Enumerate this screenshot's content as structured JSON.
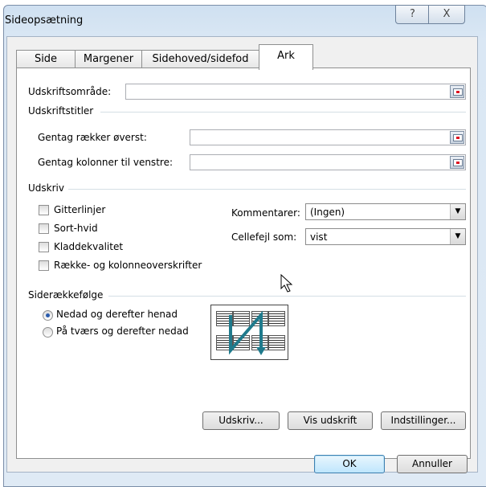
{
  "window": {
    "title": "Sideopsætning",
    "help_glyph": "?",
    "close_glyph": "X"
  },
  "tabs": [
    {
      "label": "Side"
    },
    {
      "label": "Margener"
    },
    {
      "label": "Sidehoved/sidefod"
    },
    {
      "label": "Ark"
    }
  ],
  "print_area": {
    "label": "Udskriftsområde:",
    "value": ""
  },
  "print_titles": {
    "heading": "Udskriftstitler",
    "rows_label": "Gentag rækker øverst:",
    "rows_value": "",
    "cols_label": "Gentag kolonner til venstre:",
    "cols_value": ""
  },
  "print": {
    "heading": "Udskriv",
    "checkboxes": [
      {
        "label": "Gitterlinjer"
      },
      {
        "label": "Sort-hvid"
      },
      {
        "label": "Kladdekvalitet"
      },
      {
        "label": "Række- og kolonneoverskrifter"
      }
    ],
    "comments_label": "Kommentarer:",
    "comments_value": "(Ingen)",
    "errors_label": "Cellefejl som:",
    "errors_value": "vist"
  },
  "page_order": {
    "heading": "Siderækkefølge",
    "option1": "Nedad og derefter henad",
    "option2": "På tværs og derefter nedad",
    "selected": "option1"
  },
  "buttons": {
    "print": "Udskriv...",
    "preview": "Vis udskrift",
    "options": "Indstillinger...",
    "ok": "OK",
    "cancel": "Annuller"
  },
  "colors": {
    "accent": "#2a5cad",
    "arrow": "#1f7a8c"
  }
}
